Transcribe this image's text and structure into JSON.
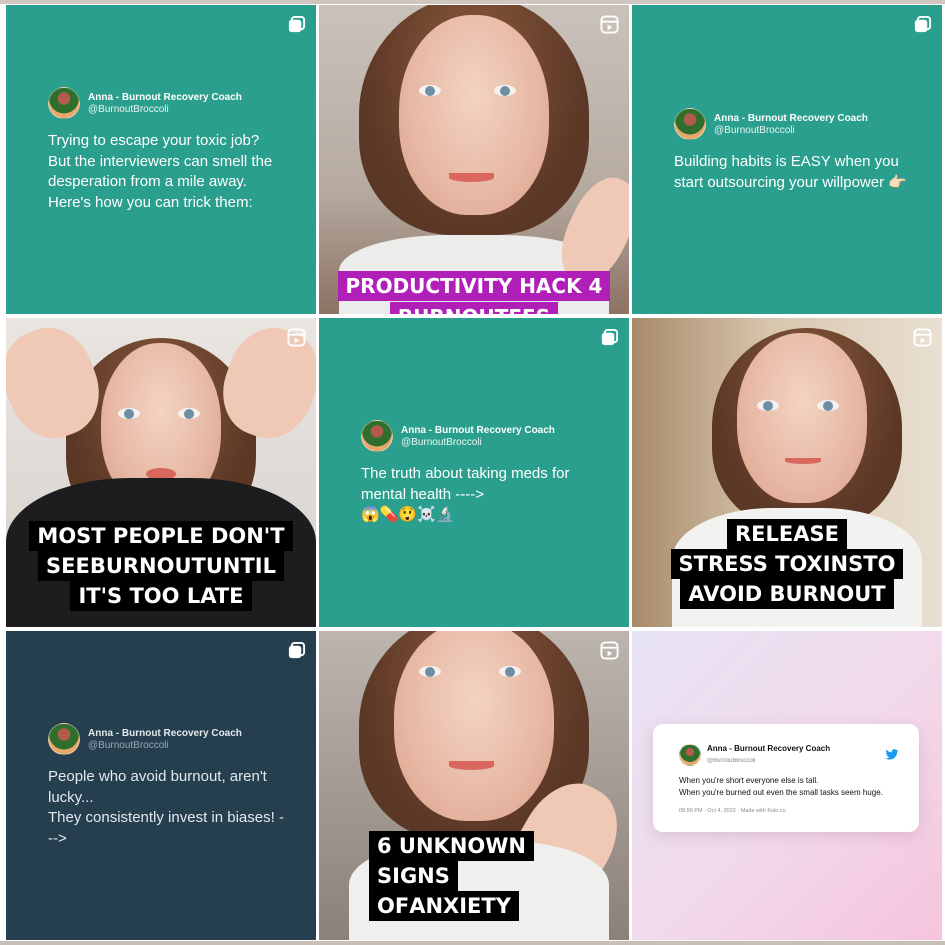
{
  "colors": {
    "teal": "#2b9f8d",
    "navy": "#253f4f",
    "caption_pink": "#ff2d7a",
    "caption_red": "#ff3c4d",
    "caption_purple": "#b11fb9",
    "twitter_blue": "#1d9bf0"
  },
  "author": {
    "name": "Anna - Burnout Recovery Coach",
    "handle": "@BurnoutBroccoli"
  },
  "posts": [
    {
      "type": "carousel",
      "icon": "carousel-icon",
      "text": "Trying to escape your toxic job?\nBut the interviewers can smell the desperation from a mile away.\nHere's how you can trick them:"
    },
    {
      "type": "reel",
      "icon": "reel-icon",
      "caption": [
        "PRODUCTIVITY HACK 4",
        "BURNOUTEES"
      ]
    },
    {
      "type": "carousel",
      "icon": "carousel-icon",
      "text": "Building habits is EASY when you start outsourcing your willpower 👉🏻"
    },
    {
      "type": "reel",
      "icon": "reel-icon",
      "caption": {
        "line1": "MOST PEOPLE DON'T",
        "line2_a": "SEE ",
        "line2_b": "BURNOUT",
        "line2_c": " UNTIL",
        "line3": "IT'S TOO LATE"
      }
    },
    {
      "type": "carousel",
      "icon": "carousel-icon",
      "text": "The truth about taking meds for mental health ---->\n😱💊😲☠️🔬"
    },
    {
      "type": "reel",
      "icon": "reel-icon",
      "caption": {
        "line1": "RELEASE",
        "line2_a": "STRESS TOXINS",
        "line2_b": " TO",
        "line3": "AVOID BURNOUT"
      }
    },
    {
      "type": "carousel",
      "icon": "carousel-icon",
      "text": "People who avoid burnout, aren't lucky...\nThey consistently invest in biases! --->"
    },
    {
      "type": "reel",
      "icon": "reel-icon",
      "caption": {
        "line1": "6 UNKNOWN",
        "line2": "SIGNS",
        "line3_a": "OF ",
        "line3_b": "ANXIETY"
      }
    },
    {
      "type": "post",
      "icon": "twitter-bird-icon",
      "text": "When you're short everyone else is tall.\nWhen you're burned out even the small tasks seem huge.",
      "meta": "08:56 PM · Oct 4, 2022 · Made with Kolo.co"
    }
  ]
}
